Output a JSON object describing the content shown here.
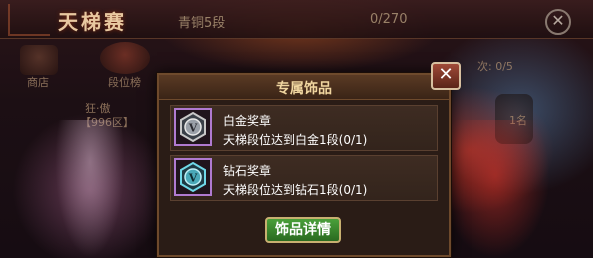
{
  "header": {
    "title": "天梯赛",
    "rank_name": "青铜5段",
    "rank_progress": "0/270"
  },
  "background": {
    "shop_label": "商店",
    "rank_board_label": "段位榜",
    "player_name": "狂·傲",
    "player_server": "【996区】",
    "right_counter": "次: 0/5",
    "right_slot_text": "1名"
  },
  "modal": {
    "title": "专属饰品",
    "close_icon": "close-icon",
    "items": [
      {
        "name": "白金奖章",
        "desc": "天梯段位达到白金1段(0/1)",
        "medal_letter": "V",
        "medal_color": "#c8c8c8"
      },
      {
        "name": "钻石奖章",
        "desc": "天梯段位达到钻石1段(0/1)",
        "medal_letter": "V",
        "medal_color": "#6fd8e8"
      }
    ],
    "detail_button": "饰品详情"
  },
  "colors": {
    "modal_bg": "#2a1c16",
    "modal_border": "#6e4a2c",
    "title_gold": "#f0d6a0",
    "button_green": "#4aa03a",
    "medal_border": "#b07ad0"
  }
}
